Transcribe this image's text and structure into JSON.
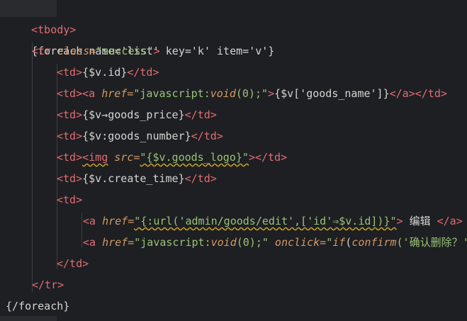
{
  "lines": [
    {
      "id": "l1",
      "parts": [
        "<tbody>"
      ]
    },
    {
      "id": "l2",
      "parts": [
        "{foreach name='list' key='k' item='v'}"
      ]
    },
    {
      "id": "l3",
      "parts": [
        "<tr",
        " class=",
        "\"success\"",
        ">"
      ]
    },
    {
      "id": "l4",
      "parts": [
        "<td>",
        "{$v.id}",
        "</td>"
      ]
    },
    {
      "id": "l5",
      "parts": [
        "<td>",
        "<a",
        " href=",
        "\"javascript:",
        "void",
        "(0);\"",
        ">",
        "{$v['goods_name']}",
        "</a>",
        "</td>"
      ]
    },
    {
      "id": "l6",
      "parts": [
        "<td>",
        "{$v→goods_price}",
        "</td>"
      ]
    },
    {
      "id": "l7",
      "parts": [
        "<td>",
        "{$v:goods_number}",
        "</td>"
      ]
    },
    {
      "id": "l8",
      "parts": [
        "<td>",
        "<img",
        " src=",
        "\"{$v.goods_logo}\"",
        "></td>"
      ]
    },
    {
      "id": "l9",
      "parts": [
        "<td>",
        "{$v.create_time}",
        "</td>"
      ]
    },
    {
      "id": "l10",
      "parts": [
        "<td>"
      ]
    },
    {
      "id": "l11",
      "parts": [
        "<a",
        " href=",
        "\"{:url('admin/goods/edit',['id'⇒$v.id])}\"",
        ">",
        " 编辑 ",
        "</a>"
      ]
    },
    {
      "id": "l12",
      "parts": [
        "<a",
        " href=",
        "\"javascript:",
        "void",
        "(0);\"",
        " onclick=",
        "\"",
        "if",
        "(",
        "confirm",
        "('确认删除？'"
      ]
    },
    {
      "id": "l13",
      "parts": [
        "</td>"
      ]
    },
    {
      "id": "l14",
      "parts": [
        "</tr>"
      ]
    },
    {
      "id": "l15",
      "parts": [
        "{/foreach}"
      ]
    }
  ],
  "colors": {
    "background": "#1e1f22",
    "tag": "#e06c75",
    "attribute": "#d19a66",
    "string": "#98c379",
    "text": "#d4d4d4",
    "warning_underline": "#c9a227"
  }
}
